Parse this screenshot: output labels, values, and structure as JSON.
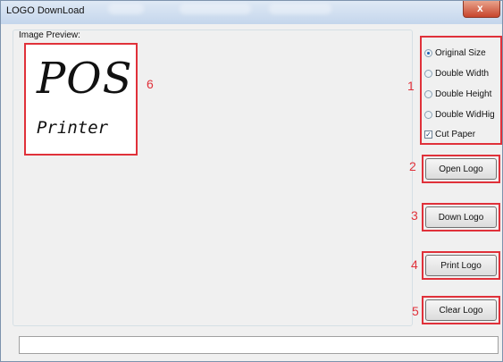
{
  "window": {
    "title": "LOGO DownLoad",
    "close_glyph": "x"
  },
  "preview": {
    "group_label": "Image Preview:",
    "logo_line1": "POS",
    "logo_line2": "Printer",
    "annotation": "6"
  },
  "options": {
    "annotation": "1",
    "radios": [
      {
        "label": "Original Size",
        "checked": true
      },
      {
        "label": "Double Width",
        "checked": false
      },
      {
        "label": "Double Height",
        "checked": false
      },
      {
        "label": "Double WidHig",
        "checked": false
      }
    ],
    "cut_paper": {
      "label": "Cut Paper",
      "checked": true,
      "mark": "✓"
    }
  },
  "buttons": [
    {
      "label": "Open Logo",
      "annotation": "2"
    },
    {
      "label": "Down Logo",
      "annotation": "3"
    },
    {
      "label": "Print Logo",
      "annotation": "4"
    },
    {
      "label": "Clear Logo",
      "annotation": "5"
    }
  ],
  "status": {
    "value": ""
  },
  "colors": {
    "annotation": "#e0313a",
    "radio_selected": "#1f5fb0"
  }
}
